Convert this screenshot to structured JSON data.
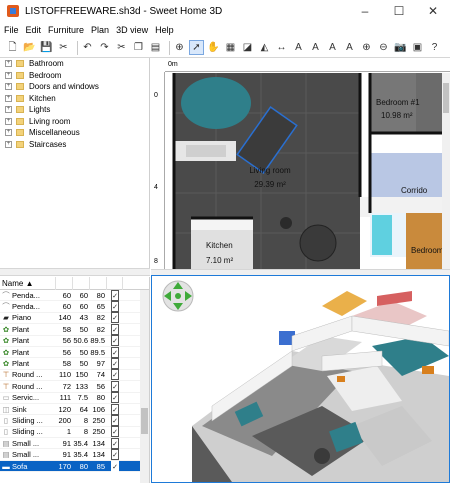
{
  "window": {
    "title": "LISTOFFREEWARE.sh3d - Sweet Home 3D",
    "controls": [
      "–",
      "☐",
      "✕"
    ]
  },
  "menu": [
    "File",
    "Edit",
    "Furniture",
    "Plan",
    "3D view",
    "Help"
  ],
  "catalog": {
    "categories": [
      "Bathroom",
      "Bedroom",
      "Doors and windows",
      "Kitchen",
      "Lights",
      "Living room",
      "Miscellaneous",
      "Staircases"
    ]
  },
  "furniture": {
    "columns": [
      "Name ▲",
      "",
      "",
      "",
      ""
    ],
    "rows": [
      {
        "name": "Penda...",
        "w": "60",
        "d": "60",
        "h": "80",
        "icon": "lamp"
      },
      {
        "name": "Penda...",
        "w": "60",
        "d": "60",
        "h": "65",
        "icon": "lamp"
      },
      {
        "name": "Piano",
        "w": "140",
        "d": "43",
        "h": "82",
        "icon": "piano"
      },
      {
        "name": "Plant",
        "w": "58",
        "d": "50",
        "h": "82",
        "icon": "plant"
      },
      {
        "name": "Plant",
        "w": "56",
        "d": "50.6",
        "h": "89.5",
        "icon": "plant"
      },
      {
        "name": "Plant",
        "w": "56",
        "d": "50",
        "h": "89.5",
        "icon": "plant"
      },
      {
        "name": "Plant",
        "w": "58",
        "d": "50",
        "h": "97",
        "icon": "plant"
      },
      {
        "name": "Round ...",
        "w": "110",
        "d": "150",
        "h": "74",
        "icon": "table"
      },
      {
        "name": "Round ...",
        "w": "72",
        "d": "133",
        "h": "56",
        "icon": "table"
      },
      {
        "name": "Servic...",
        "w": "111",
        "d": "7.5",
        "h": "80",
        "icon": "service"
      },
      {
        "name": "Sink",
        "w": "120",
        "d": "64",
        "h": "106",
        "icon": "sink"
      },
      {
        "name": "Sliding ...",
        "w": "200",
        "d": "8",
        "h": "250",
        "icon": "door"
      },
      {
        "name": "Sliding ...",
        "w": "1",
        "d": "8",
        "h": "250",
        "icon": "door"
      },
      {
        "name": "Small ...",
        "w": "91",
        "d": "35.4",
        "h": "134",
        "icon": "shelf"
      },
      {
        "name": "Small ...",
        "w": "91",
        "d": "35.4",
        "h": "134",
        "icon": "shelf"
      },
      {
        "name": "Sofa",
        "w": "170",
        "d": "80",
        "h": "85",
        "icon": "sofa",
        "selected": true
      }
    ]
  },
  "plan": {
    "ruler_origin": "0m",
    "ruler_top_marks": [
      "0m"
    ],
    "ruler_left_marks": [
      "0",
      "4",
      "8"
    ],
    "rooms": [
      {
        "name": "Bedroom #1",
        "area": "10.98 m²"
      },
      {
        "name": "Living room",
        "area": "29.39 m²"
      },
      {
        "name": "Kitchen",
        "area": "7.10 m²"
      },
      {
        "name": "Corrido"
      },
      {
        "name": "Bedroom"
      }
    ]
  },
  "colors": {
    "selection": "#0a63c4",
    "accent_teal": "#2f7f8a",
    "plan_dark": "#3a3a3a"
  }
}
